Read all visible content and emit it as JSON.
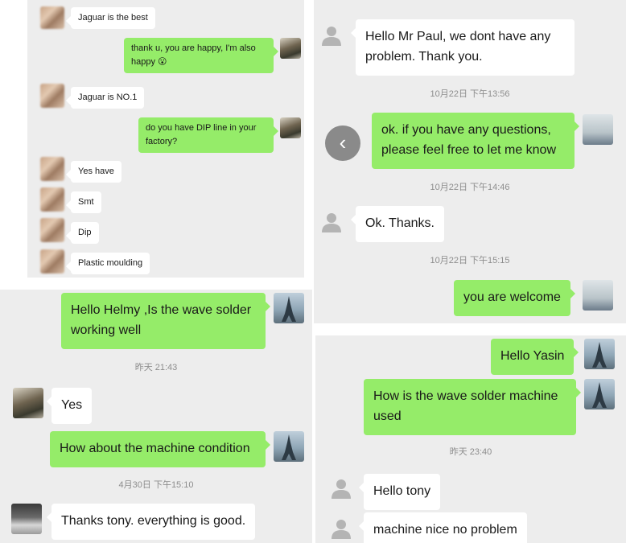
{
  "panel1": {
    "messages": [
      {
        "text": "Jaguar is the best"
      },
      {
        "text": "thank u, you are happy, I'm also happy 😮"
      },
      {
        "text": "Jaguar is NO.1"
      },
      {
        "text": "do you have DIP line in your factory?"
      },
      {
        "text": "Yes have"
      },
      {
        "text": "Smt"
      },
      {
        "text": "Dip"
      },
      {
        "text": "Plastic moulding"
      }
    ]
  },
  "panel2": {
    "messages": [
      {
        "text": "Hello Mr Paul, we dont have any problem. Thank you."
      },
      {
        "text": "ok. if you have any questions, please feel free to let me know"
      },
      {
        "text": "Ok. Thanks."
      },
      {
        "text": "you are welcome"
      }
    ],
    "timestamps": [
      "10月22日 下午13:56",
      "10月22日 下午14:46",
      "10月22日 下午15:15"
    ],
    "back_icon": "chevron-left-icon"
  },
  "panel3": {
    "messages": [
      {
        "text": "Hello Helmy ,Is the wave solder working well"
      },
      {
        "text": "Yes"
      },
      {
        "text": "How about the machine condition"
      },
      {
        "text": "Thanks tony.  everything is good."
      }
    ],
    "timestamps": [
      "昨天 21:43",
      "4月30日 下午15:10"
    ]
  },
  "panel4": {
    "messages": [
      {
        "text": "Hello Yasin"
      },
      {
        "text": "How is the wave solder machine used"
      },
      {
        "text": "Hello tony"
      },
      {
        "text": "machine nice no problem"
      }
    ],
    "timestamps": [
      "昨天 23:40"
    ]
  },
  "colors": {
    "sent_bubble": "#95ec69",
    "received_bubble": "#ffffff",
    "chat_background": "#ededed",
    "timestamp_text": "#8d8d8d"
  }
}
